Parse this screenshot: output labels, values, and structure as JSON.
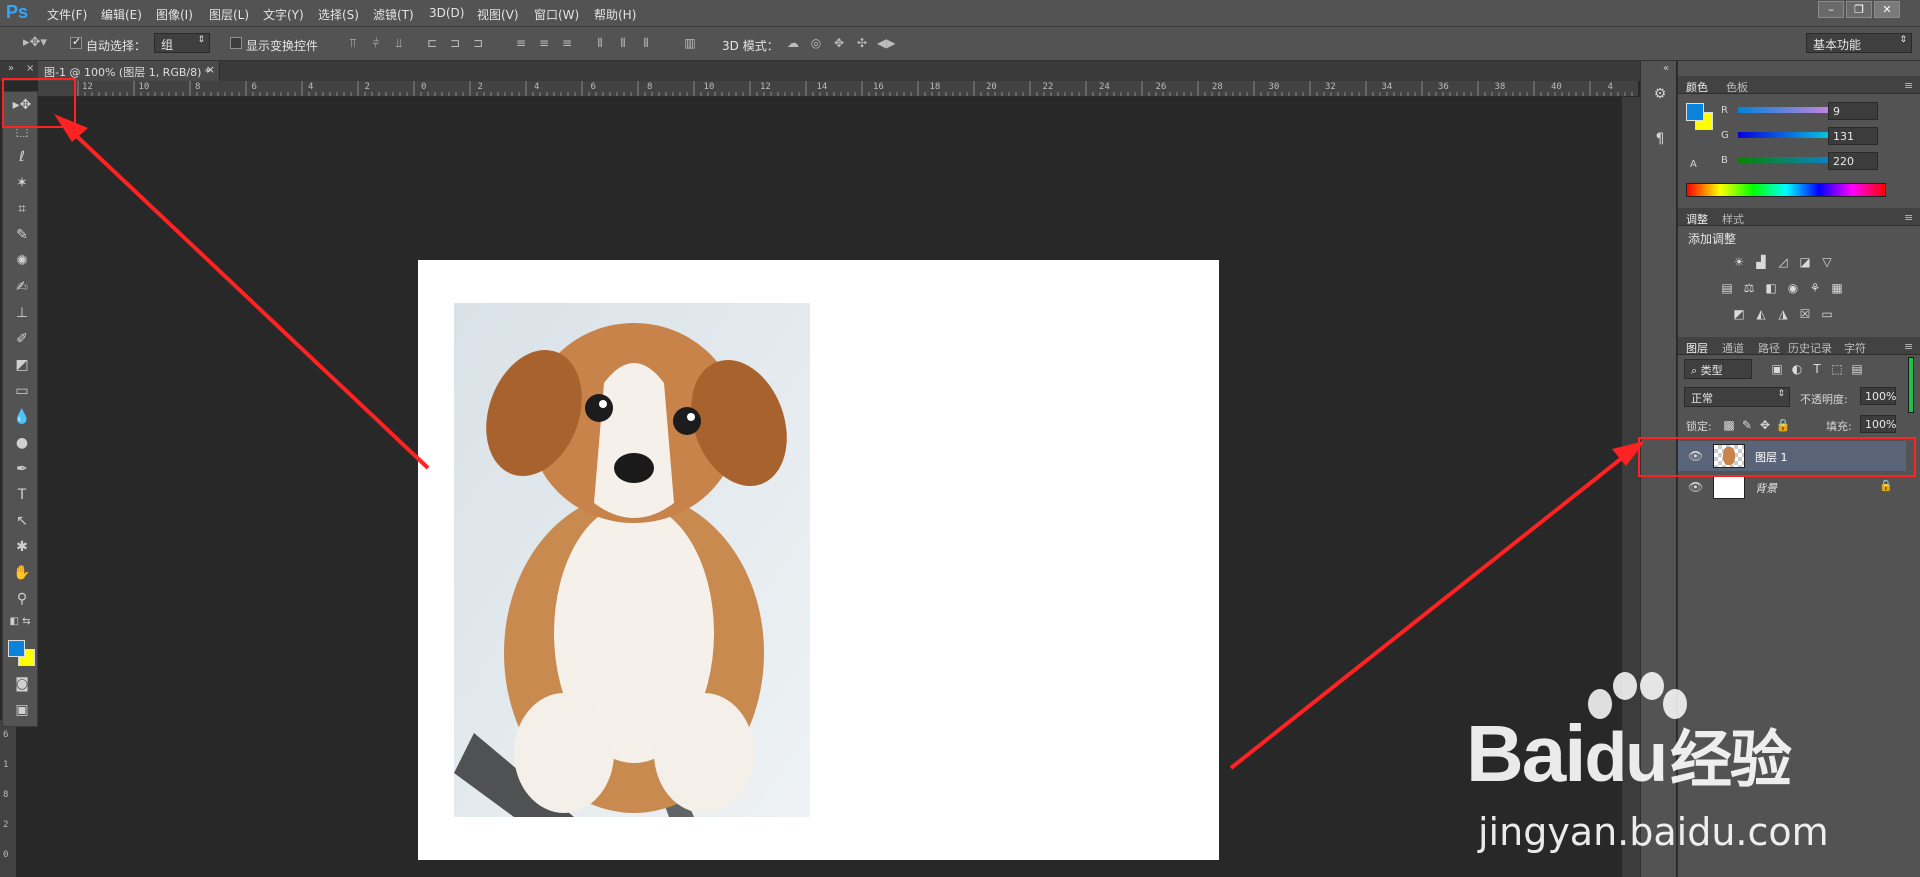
{
  "app": {
    "logo": "Ps"
  },
  "menu": [
    "文件(F)",
    "编辑(E)",
    "图像(I)",
    "图层(L)",
    "文字(Y)",
    "选择(S)",
    "滤镜(T)",
    "3D(D)",
    "视图(V)",
    "窗口(W)",
    "帮助(H)"
  ],
  "window_controls": [
    "–",
    "❐",
    "✕"
  ],
  "options": {
    "auto_select_label": "自动选择：",
    "auto_select_value": "组",
    "show_transform_label": "显示变换控件",
    "mode_3d_label": "3D 模式：",
    "workspace": "基本功能"
  },
  "document": {
    "tab_title": "图-1 @ 100% (图层 1, RGB/8) *",
    "close": "×"
  },
  "ruler_top": [
    "12",
    "10",
    "8",
    "6",
    "4",
    "2",
    "0",
    "2",
    "4",
    "6",
    "8",
    "10",
    "12",
    "14",
    "16",
    "18",
    "20",
    "22",
    "24",
    "26",
    "28",
    "30",
    "32",
    "34",
    "36",
    "38",
    "40",
    "4"
  ],
  "ruler_left": [
    "6",
    "1",
    "8",
    "2",
    "0"
  ],
  "color_panel": {
    "tabs": [
      "颜色",
      "色板"
    ],
    "r_label": "R",
    "g_label": "G",
    "b_label": "B",
    "r_value": "9",
    "g_value": "131",
    "b_value": "220",
    "foreground": "#0983dc",
    "background": "#ffff00"
  },
  "adjustments_panel": {
    "tabs": [
      "调整",
      "样式"
    ],
    "title": "添加调整"
  },
  "layers_panel": {
    "tabs": [
      "图层",
      "通道",
      "路径",
      "历史记录",
      "字符"
    ],
    "filter_kind": "类型",
    "blend_mode": "正常",
    "opacity_label": "不透明度:",
    "opacity_value": "100%",
    "lock_label": "锁定:",
    "fill_label": "填充:",
    "fill_value": "100%",
    "layers": [
      {
        "name": "图层 1",
        "selected": true
      },
      {
        "name": "背景",
        "selected": false
      }
    ]
  },
  "watermark": {
    "brand": "Bai",
    "brand2": "du",
    "brand3": "经验",
    "url": "jingyan.baidu.com"
  },
  "colors": {
    "annotation": "#ff2222",
    "accent": "#31a8ff",
    "selected_layer": "#5a6478"
  }
}
